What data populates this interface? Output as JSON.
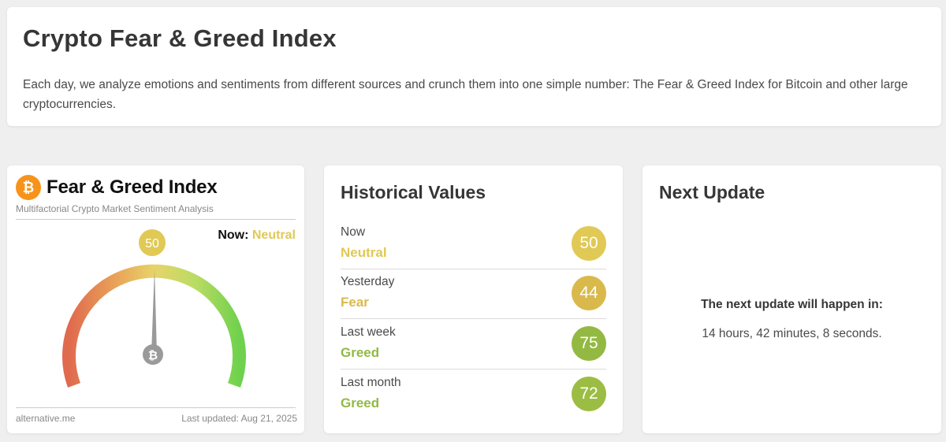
{
  "header": {
    "title": "Crypto Fear & Greed Index",
    "description": "Each day, we analyze emotions and sentiments from different sources and crunch them into one simple number: The Fear & Greed Index for Bitcoin and other large cryptocurrencies."
  },
  "widget": {
    "logo_symbol": "₿",
    "title": "Fear & Greed Index",
    "subtitle": "Multifactorial Crypto Market Sentiment Analysis",
    "now_label": "Now:",
    "now_classification": "Neutral",
    "value": "50",
    "gauge_min": 0,
    "gauge_max": 100,
    "footer_left": "alternative.me",
    "footer_right": "Last updated: Aug 21, 2025"
  },
  "historical": {
    "title": "Historical Values",
    "rows": [
      {
        "label": "Now",
        "classification": "Neutral",
        "value": "50",
        "color": "#e0c955"
      },
      {
        "label": "Yesterday",
        "classification": "Fear",
        "value": "44",
        "color": "#d9b94c"
      },
      {
        "label": "Last week",
        "classification": "Greed",
        "value": "75",
        "color": "#93b943"
      },
      {
        "label": "Last month",
        "classification": "Greed",
        "value": "72",
        "color": "#9bbd43"
      }
    ]
  },
  "next_update": {
    "title": "Next Update",
    "message": "The next update will happen in:",
    "countdown": "14 hours, 42 minutes, 8 seconds."
  },
  "colors": {
    "neutral": "#e0c955",
    "fear": "#d9b94c",
    "greed": "#93b943",
    "btc_orange": "#f7931a"
  }
}
